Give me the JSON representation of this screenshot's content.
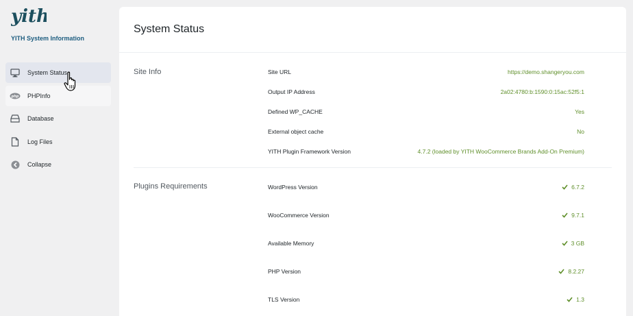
{
  "brand": {
    "logo_text": "yith",
    "title": "YITH System Information"
  },
  "sidebar": {
    "items": [
      {
        "label": "System Status",
        "icon": "monitor-icon"
      },
      {
        "label": "PHPInfo",
        "icon": "php-icon"
      },
      {
        "label": "Database",
        "icon": "database-icon"
      },
      {
        "label": "Log Files",
        "icon": "document-icon"
      },
      {
        "label": "Collapse",
        "icon": "collapse-arrow-icon"
      }
    ]
  },
  "main": {
    "title": "System Status",
    "site_info": {
      "title": "Site Info",
      "rows": [
        {
          "label": "Site URL",
          "value": "https://demo.shangeryou.com"
        },
        {
          "label": "Output IP Address",
          "value": "2a02:4780:b:1590:0:15ac:52f5:1"
        },
        {
          "label": "Defined WP_CACHE",
          "value": "Yes"
        },
        {
          "label": "External object cache",
          "value": "No"
        },
        {
          "label": "YITH Plugin Framework Version",
          "value": "4.7.2 (loaded by YITH WooCommerce Brands Add-On Premium)"
        }
      ]
    },
    "plugins_requirements": {
      "title": "Plugins Requirements",
      "rows": [
        {
          "label": "WordPress Version",
          "value": "6.7.2"
        },
        {
          "label": "WooCommerce Version",
          "value": "9.7.1"
        },
        {
          "label": "Available Memory",
          "value": "3 GB"
        },
        {
          "label": "PHP Version",
          "value": "8.2.27"
        },
        {
          "label": "TLS Version",
          "value": "1.3"
        }
      ]
    }
  },
  "colors": {
    "accent": "#1c5c7f",
    "success": "#5f8f2a",
    "active_bg": "#e3e6ee"
  }
}
